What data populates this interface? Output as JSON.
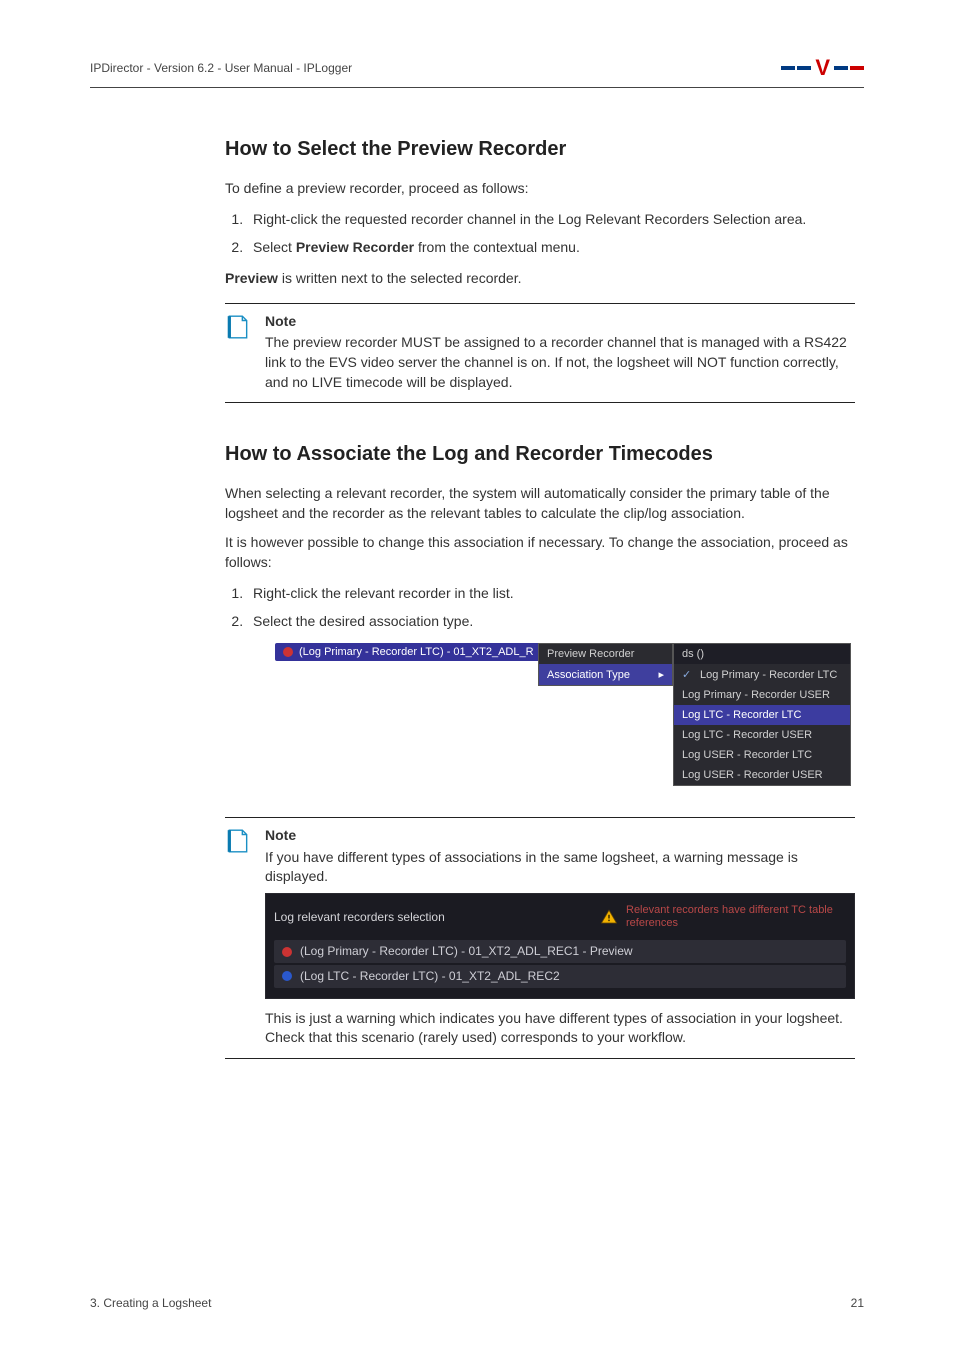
{
  "header": {
    "doc_title": "IPDirector - Version 6.2 - User Manual - IPLogger"
  },
  "section1": {
    "heading": "How to Select the Preview Recorder",
    "intro": "To define a preview recorder, proceed as follows:",
    "steps": [
      "Right-click the requested recorder channel in the Log Relevant Recorders Selection area.",
      "Select Preview Recorder from the contextual menu."
    ],
    "step2_prefix": "Select ",
    "step2_bold": "Preview Recorder",
    "step2_suffix": " from the contextual menu.",
    "post_prefix": "Preview",
    "post_suffix": " is written next to the selected recorder.",
    "note_label": "Note",
    "note_body": "The preview recorder MUST be assigned to a recorder channel that is managed with a RS422 link to the EVS video server the channel is on. If not, the logsheet will NOT function correctly, and no LIVE timecode will be displayed."
  },
  "section2": {
    "heading": "How to Associate the Log and Recorder Timecodes",
    "para1": "When selecting a relevant recorder, the system will automatically consider the primary table of the logsheet and the recorder as the relevant tables to calculate the clip/log association.",
    "para2": "It is however possible to change this association if necessary. To change the association, proceed as follows:",
    "steps": [
      "Right-click the relevant recorder in the list.",
      "Select the desired association type."
    ],
    "ctx": {
      "row_label": "(Log Primary - Recorder LTC) - 01_XT2_ADL_R",
      "menu1": [
        "Preview Recorder",
        "Association Type"
      ],
      "menu2_top": "ds ()",
      "menu2": [
        "Log Primary - Recorder LTC",
        "Log Primary - Recorder USER",
        "Log LTC - Recorder LTC",
        "Log LTC - Recorder USER",
        "Log USER - Recorder LTC",
        "Log USER - Recorder USER"
      ]
    },
    "note_label": "Note",
    "note_intro": "If you have different types of associations in the same logsheet, a warning message is displayed.",
    "warn": {
      "header_label": "Log relevant recorders selection",
      "header_msg": "Relevant recorders have different TC table references",
      "rows": [
        "(Log Primary - Recorder LTC) - 01_XT2_ADL_REC1 - Preview",
        "(Log LTC - Recorder LTC) - 01_XT2_ADL_REC2"
      ]
    },
    "note_tail": "This is just a warning which indicates you have different types of association in your logsheet. Check that this scenario (rarely used) corresponds to your workflow."
  },
  "footer": {
    "chapter": "3. Creating a Logsheet",
    "page": "21"
  }
}
